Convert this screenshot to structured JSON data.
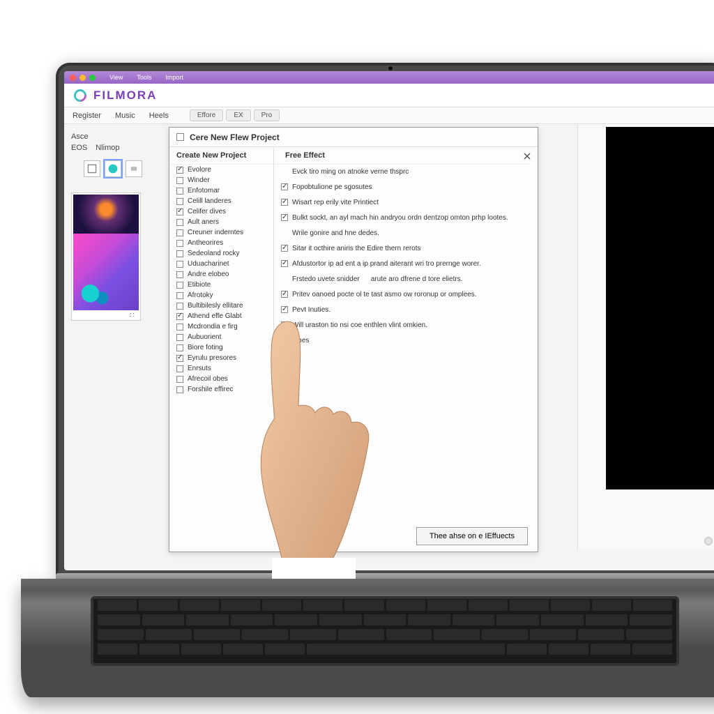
{
  "menubar": [
    "View",
    "Tools",
    "Import"
  ],
  "brand": "FILMORA",
  "tabs_left": [
    "Register",
    "Music",
    "Heels"
  ],
  "tabs_right": [
    "Effore",
    "EX",
    "Pro"
  ],
  "sidebar": {
    "links": [
      "Asce",
      "EOS",
      "Nlimop"
    ],
    "preview_dots": "::"
  },
  "dialog": {
    "title": "Cere New Flew Project",
    "left_hdr": "Create New Project",
    "right_hdr": "Free Effect",
    "left_items": [
      {
        "label": "Evolore",
        "checked": true
      },
      {
        "label": "Winder",
        "checked": false
      },
      {
        "label": "Enfotomar",
        "checked": false
      },
      {
        "label": "Celill landeres",
        "checked": false
      },
      {
        "label": "Celifer dives",
        "checked": true
      },
      {
        "label": "Ault aners",
        "checked": false
      },
      {
        "label": "Creuner inderntes",
        "checked": false
      },
      {
        "label": "Antheorires",
        "checked": false
      },
      {
        "label": "Sedeoland rocky",
        "checked": false
      },
      {
        "label": "Uduacharinet",
        "checked": false
      },
      {
        "label": "Andre elobeo",
        "checked": false
      },
      {
        "label": "Etibiote",
        "checked": false
      },
      {
        "label": "Afrotoky",
        "checked": false
      },
      {
        "label": "Bultibilesly ellitare",
        "checked": false
      },
      {
        "label": "Athend effe Glabt",
        "checked": true
      },
      {
        "label": "Mcdrondia e firg",
        "checked": false
      },
      {
        "label": "Aubuorient",
        "checked": false
      },
      {
        "label": "Biore foting",
        "checked": false
      },
      {
        "label": "Eyrulu presores",
        "checked": true
      },
      {
        "label": "Enrsuts",
        "checked": false
      },
      {
        "label": "Afrecoil obes",
        "checked": false
      },
      {
        "label": "Forshile effirec",
        "checked": false
      }
    ],
    "right_items": [
      {
        "label": "Evck tiro ming on atnoke verne thsprc",
        "checked": false,
        "plain": true
      },
      {
        "label": "Fopobtulione pe sgosutes",
        "checked": true
      },
      {
        "label": "Wisart rep erily vite Printiect",
        "checked": true
      },
      {
        "label": "Bulkt sockt, an ayl mach hin andryou ordn dentzop omton prhp lootes.",
        "checked": true
      },
      {
        "label": "Wrile gonire and hne dedes.",
        "checked": false,
        "plain": true
      },
      {
        "label": "Sitar it octhire aniris the Edire thern rerots",
        "checked": true
      },
      {
        "label": "Afdustortor ip ad ent a ip prand aiterant wri tro prernge worer.",
        "checked": true
      },
      {
        "label": "Frstedo uvete snidder",
        "checked": false,
        "plain": true,
        "hl": "arute aro dfrene d tore elietrs."
      },
      {
        "label": "Pritev oanoed pocte ol te tast asmo ow roronup or omplees.",
        "checked": true
      },
      {
        "label": "Pevt Inuties.",
        "checked": true
      },
      {
        "label": "Will uraston tio nsi coe enthlen vlint omkien.",
        "checked": true
      },
      {
        "label": "emes",
        "checked": false,
        "plain": true
      }
    ],
    "button": "Thee ahse on e IEffuects"
  }
}
